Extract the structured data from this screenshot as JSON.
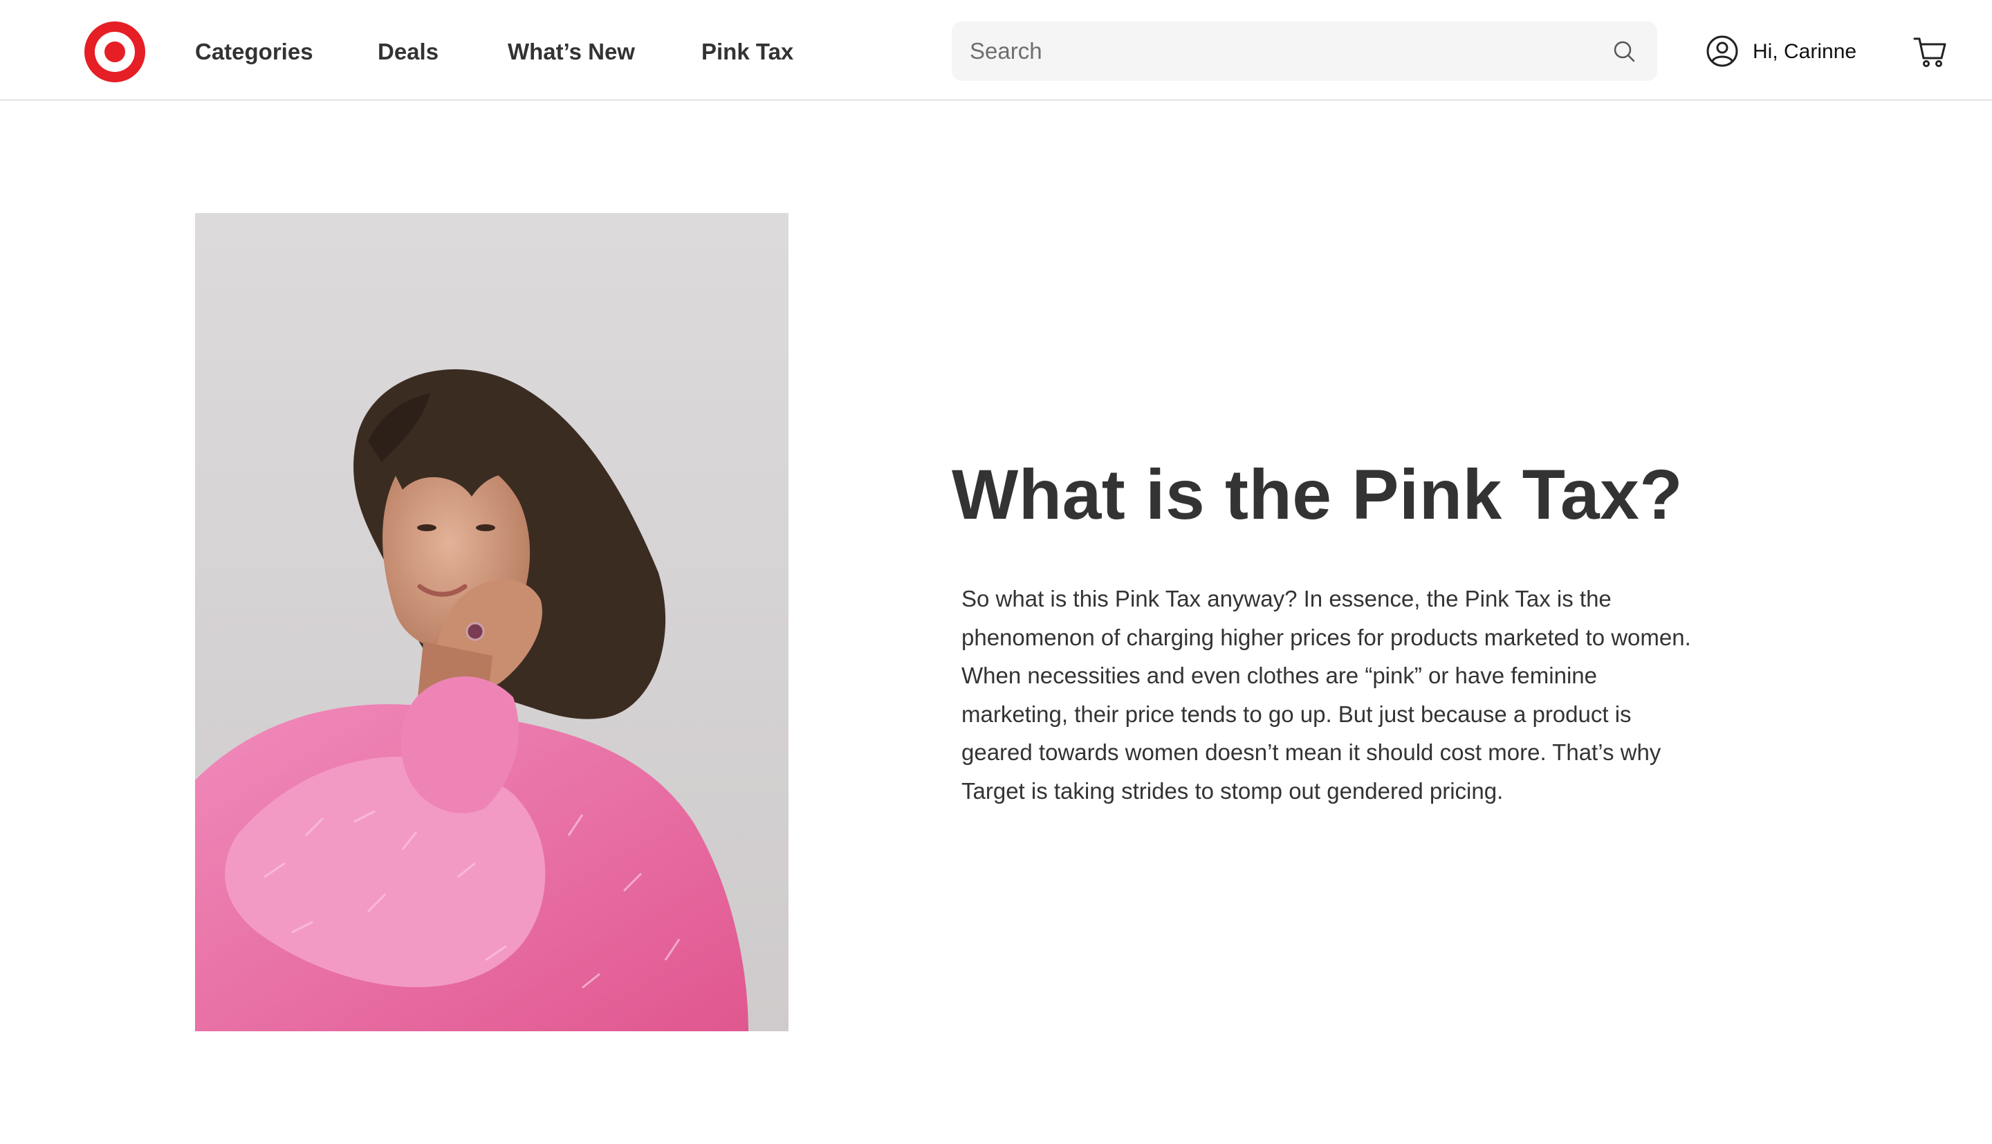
{
  "brand": {
    "name": "Target",
    "color": "#e61e25",
    "logo_icon": "target-bullseye-icon"
  },
  "nav": {
    "items": [
      {
        "label": "Categories"
      },
      {
        "label": "Deals"
      },
      {
        "label": "What’s New"
      },
      {
        "label": "Pink Tax"
      }
    ]
  },
  "search": {
    "placeholder": "Search",
    "value": "",
    "icon": "search-icon"
  },
  "account": {
    "greeting": "Hi, Carinne",
    "icon": "user-circle-icon"
  },
  "cart": {
    "icon": "shopping-cart-icon"
  },
  "hero": {
    "image": "person-in-pink-sweater-photo",
    "title": "What is the Pink Tax?",
    "body": "So what is this Pink Tax anyway? In essence, the Pink Tax is the phenomenon of charging higher prices for products marketed to women. When necessities and even clothes are “pink” or have feminine marketing, their price tends to go up. But just because a product is geared towards women doesn’t mean it should cost more. That’s why Target is taking strides to stomp out gendered pricing."
  },
  "colors": {
    "text": "#333333",
    "accent": "#e61e25",
    "pink": "#ec6ea6",
    "search_bg": "#f5f5f5"
  }
}
